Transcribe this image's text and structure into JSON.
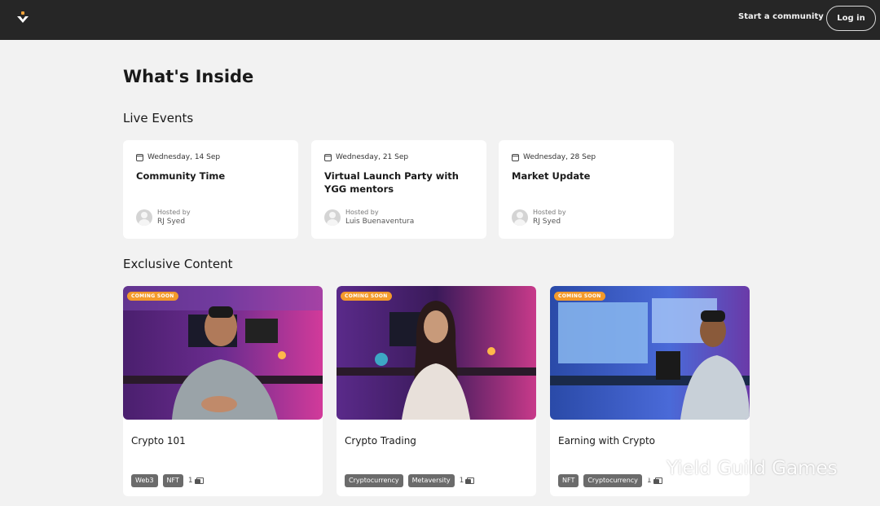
{
  "header": {
    "start_community": "Start a community",
    "login": "Log in"
  },
  "page": {
    "title": "What's Inside"
  },
  "live_events": {
    "heading": "Live Events",
    "items": [
      {
        "date": "Wednesday, 14 Sep",
        "title": "Community Time",
        "hosted_by": "Hosted by",
        "host": "RJ Syed"
      },
      {
        "date": "Wednesday, 21 Sep",
        "title": "Virtual Launch Party with YGG mentors",
        "hosted_by": "Hosted by",
        "host": "Luis Buenaventura"
      },
      {
        "date": "Wednesday, 28 Sep",
        "title": "Market Update",
        "hosted_by": "Hosted by",
        "host": "RJ Syed"
      }
    ]
  },
  "exclusive": {
    "heading": "Exclusive Content",
    "items": [
      {
        "badge": "COMING SOON",
        "title": "Crypto 101",
        "tags": [
          "Web3",
          "NFT"
        ],
        "count": "1"
      },
      {
        "badge": "COMING SOON",
        "title": "Crypto Trading",
        "tags": [
          "Cryptocurrency",
          "Metaversity"
        ],
        "count": "1"
      },
      {
        "badge": "COMING SOON",
        "title": "Earning with Crypto",
        "tags": [
          "NFT",
          "Cryptocurrency"
        ],
        "count": "1"
      }
    ]
  },
  "watermark": {
    "text": "Yield Guild Games"
  },
  "colors": {
    "header_bg": "#262626",
    "page_bg": "#f2f2f2",
    "badge": "#f39a2b",
    "tag_bg": "#6b6b6b"
  }
}
